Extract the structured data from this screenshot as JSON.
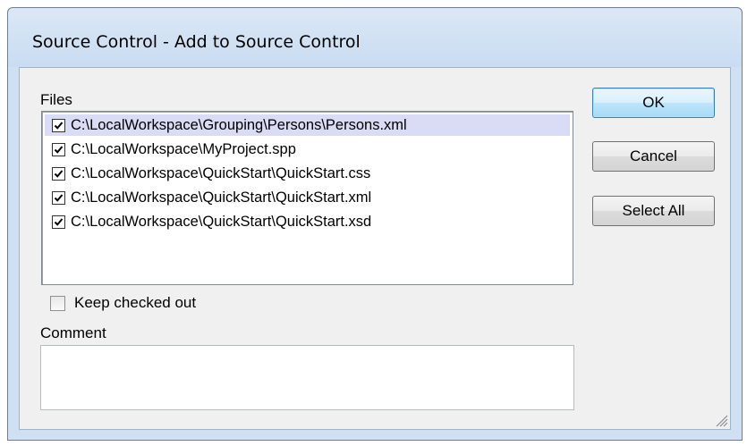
{
  "window": {
    "title": "Source Control - Add to Source Control"
  },
  "files": {
    "label": "Files",
    "items": [
      {
        "path": "C:\\LocalWorkspace\\Grouping\\Persons\\Persons.xml",
        "checked": true,
        "selected": true
      },
      {
        "path": "C:\\LocalWorkspace\\MyProject.spp",
        "checked": true,
        "selected": false
      },
      {
        "path": "C:\\LocalWorkspace\\QuickStart\\QuickStart.css",
        "checked": true,
        "selected": false
      },
      {
        "path": "C:\\LocalWorkspace\\QuickStart\\QuickStart.xml",
        "checked": true,
        "selected": false
      },
      {
        "path": "C:\\LocalWorkspace\\QuickStart\\QuickStart.xsd",
        "checked": true,
        "selected": false
      }
    ]
  },
  "keep_checked_out": {
    "label": "Keep checked out",
    "checked": false
  },
  "comment": {
    "label": "Comment",
    "value": ""
  },
  "buttons": {
    "ok": "OK",
    "cancel": "Cancel",
    "select_all": "Select All"
  },
  "icons": {
    "check": "checkmark-icon",
    "resize": "resize-grip-icon"
  }
}
